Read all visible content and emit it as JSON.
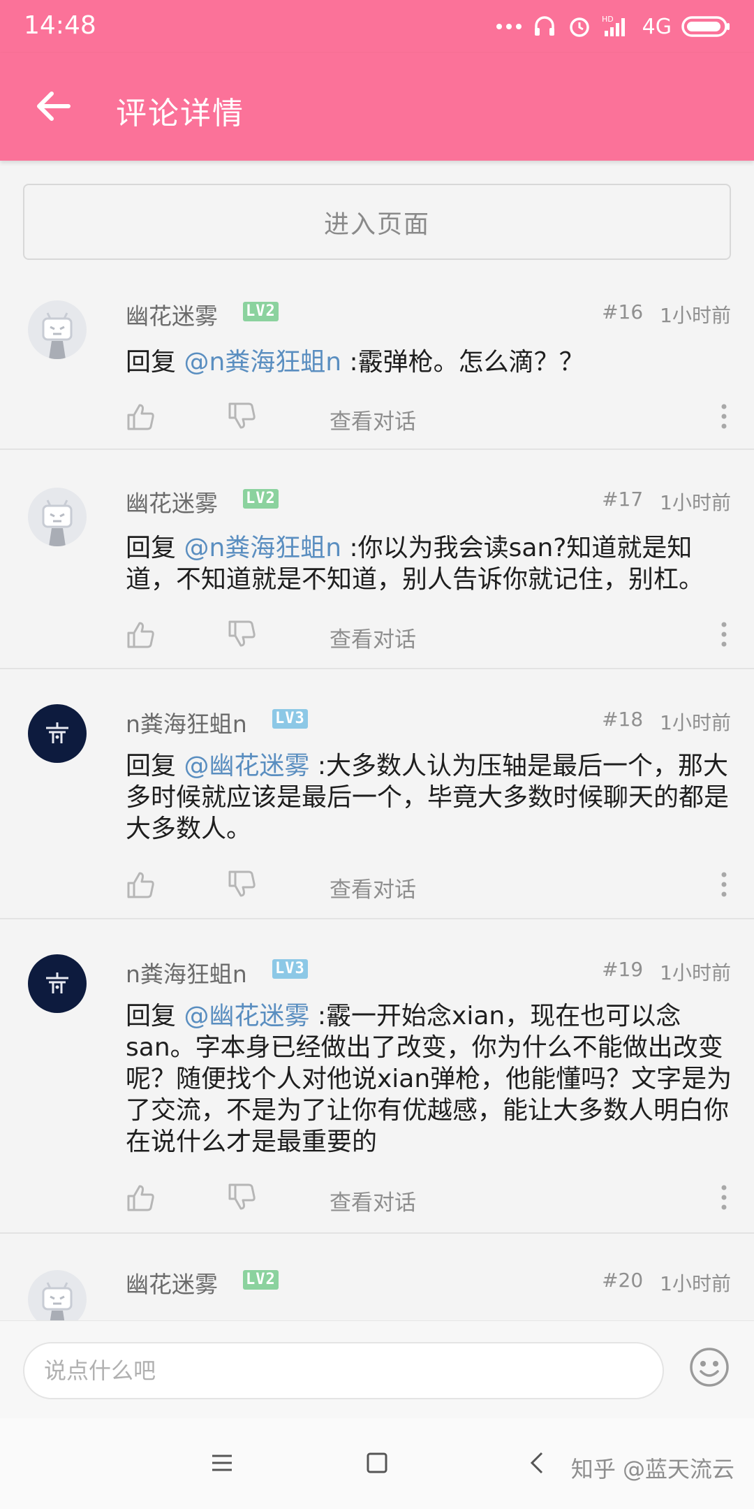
{
  "status_bar": {
    "time": "14:48",
    "network_type": "4G"
  },
  "app_bar": {
    "title": "评论详情"
  },
  "enter_page_label": "进入页面",
  "comments": [
    {
      "username": "幽花迷雾",
      "level": "LV2",
      "floor": "#16",
      "time": "1小时前",
      "reply_prefix": "回复 ",
      "reply_to": "@n粪海狂蛆n",
      "text": " :霰弹枪。怎么滴？？",
      "view_dialog": "查看对话"
    },
    {
      "username": "幽花迷雾",
      "level": "LV2",
      "floor": "#17",
      "time": "1小时前",
      "reply_prefix": "回复 ",
      "reply_to": "@n粪海狂蛆n",
      "text": " :你以为我会读san?知道就是知道，不知道就是不知道，别人告诉你就记住，别杠。",
      "view_dialog": "查看对话"
    },
    {
      "username": "n粪海狂蛆n",
      "level": "LV3",
      "floor": "#18",
      "time": "1小时前",
      "reply_prefix": "回复 ",
      "reply_to": "@幽花迷雾",
      "text": " :大多数人认为压轴是最后一个，那大多时候就应该是最后一个，毕竟大多数时候聊天的都是大多数人。",
      "view_dialog": "查看对话"
    },
    {
      "username": "n粪海狂蛆n",
      "level": "LV3",
      "floor": "#19",
      "time": "1小时前",
      "reply_prefix": "回复 ",
      "reply_to": "@幽花迷雾",
      "text": " :霰一开始念xian，现在也可以念san。字本身已经做出了改变，你为什么不能做出改变呢？随便找个人对他说xian弹枪，他能懂吗？文字是为了交流，不是为了让你有优越感，能让大多数人明白你在说什么才是最重要的",
      "view_dialog": "查看对话"
    },
    {
      "username": "幽花迷雾",
      "level": "LV2",
      "floor": "#20",
      "time": "1小时前"
    }
  ],
  "input": {
    "placeholder": "说点什么吧"
  },
  "watermark": "知乎 @蓝天流云",
  "colors": {
    "accent": "#fb7299",
    "mention": "#5a8ec0"
  }
}
